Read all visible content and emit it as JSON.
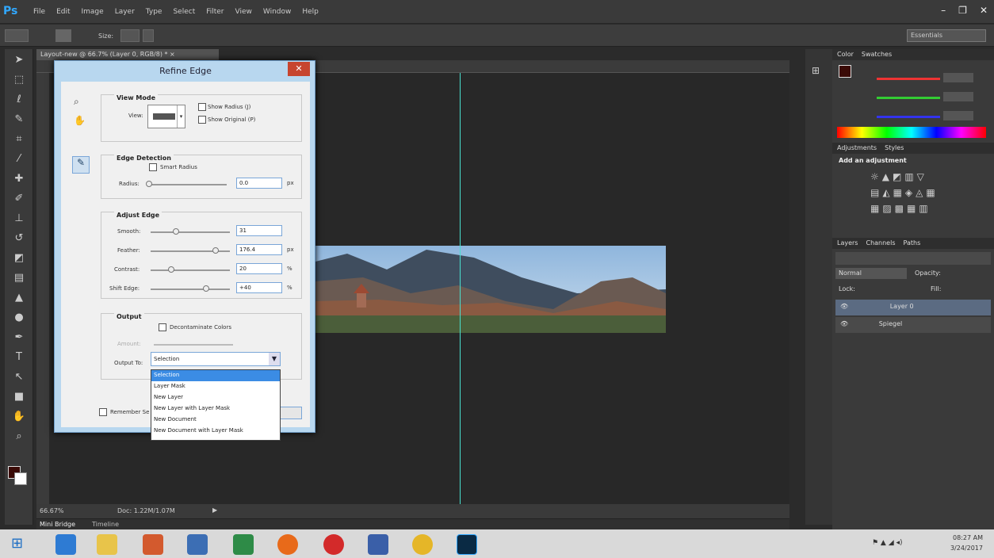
{
  "app": {
    "logo": "Ps",
    "menu": [
      "File",
      "Edit",
      "Image",
      "Layer",
      "Type",
      "Select",
      "Filter",
      "View",
      "Window",
      "Help"
    ],
    "window_controls": [
      "–",
      "❐",
      "✕"
    ]
  },
  "options_bar": {
    "size_label": "Size:",
    "workspace": "Essentials"
  },
  "document": {
    "tab_title": "Layout-new @ 66.7% (Layer 0, RGB/8) * ×",
    "zoom": "66.67%",
    "doc_size": "Doc: 1.22M/1.07M"
  },
  "bottom_bar": {
    "tabs": [
      "Mini Bridge",
      "Timeline"
    ]
  },
  "panels": {
    "color_tabs": [
      "Color",
      "Swatches"
    ],
    "adjustments_tabs": [
      "Adjustments",
      "Styles"
    ],
    "add_adjustment": "Add an adjustment",
    "layers_tabs": [
      "Layers",
      "Channels",
      "Paths"
    ],
    "blend_mode": "Normal",
    "opacity_label": "Opacity:",
    "lock_label": "Lock:",
    "fill_label": "Fill:",
    "layers": [
      {
        "name": "Layer 0"
      },
      {
        "name": "Spiegel"
      }
    ]
  },
  "dialog": {
    "title": "Refine Edge",
    "close": "✕",
    "view_mode": {
      "heading": "View Mode",
      "view_label": "View:",
      "show_radius": "Show Radius (J)",
      "show_original": "Show Original (P)"
    },
    "edge_detection": {
      "heading": "Edge Detection",
      "smart_radius": "Smart Radius",
      "radius_label": "Radius:",
      "radius_value": "0.0",
      "unit": "px"
    },
    "adjust_edge": {
      "heading": "Adjust Edge",
      "rows": [
        {
          "label": "Smooth:",
          "value": "31",
          "unit": ""
        },
        {
          "label": "Feather:",
          "value": "176.4",
          "unit": "px"
        },
        {
          "label": "Contrast:",
          "value": "20",
          "unit": "%"
        },
        {
          "label": "Shift Edge:",
          "value": "+40",
          "unit": "%"
        }
      ]
    },
    "output": {
      "heading": "Output",
      "decontaminate": "Decontaminate Colors",
      "amount_label": "Amount:",
      "output_to_label": "Output To:",
      "output_to_value": "Selection",
      "remember": "Remember Se"
    },
    "dropdown": [
      "Selection",
      "Layer Mask",
      "New Layer",
      "New Layer with Layer Mask",
      "New Document",
      "New Document with Layer Mask"
    ]
  },
  "taskbar": {
    "time": "08:27 AM",
    "date": "3/24/2017"
  }
}
